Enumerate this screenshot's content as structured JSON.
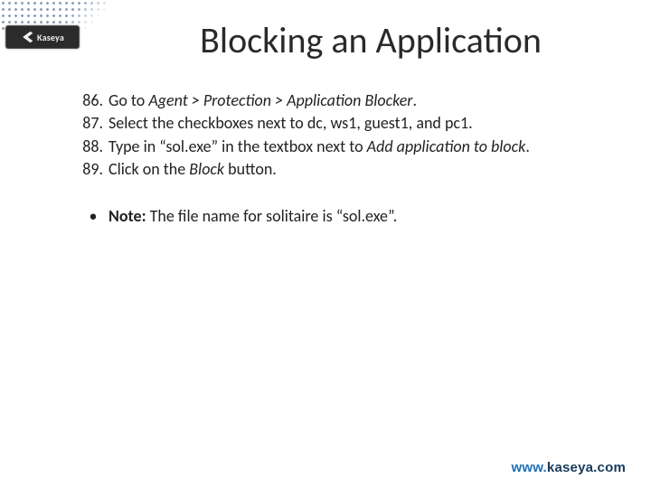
{
  "logo": {
    "brand": "Kaseya"
  },
  "title": "Blocking an Application",
  "list": {
    "start": 86,
    "items": [
      {
        "n": "86.",
        "html": "Go to <em>Agent > Protection > Application Blocker</em>."
      },
      {
        "n": "87.",
        "html": "Select the checkboxes next to dc, ws1, guest1, and pc1."
      },
      {
        "n": "88.",
        "html": "Type in “sol.exe” in the textbox next to <em>Add application to block</em>."
      },
      {
        "n": "89.",
        "html": "Click on the <em>Block</em> button."
      }
    ]
  },
  "note": {
    "mark": "•",
    "html": "<b>Note:</b> The file name for solitaire is “sol.exe”."
  },
  "footer": {
    "www": "www.",
    "domain": "kaseya.com"
  }
}
